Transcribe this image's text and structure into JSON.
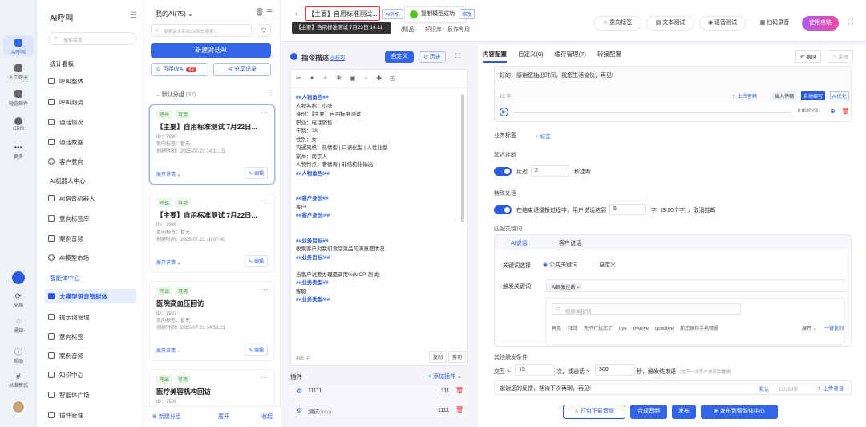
{
  "rail": {
    "items": [
      {
        "label": "AI呼叫"
      },
      {
        "label": "人工呼出"
      },
      {
        "label": "短信邮件"
      },
      {
        "label": "CRM"
      },
      {
        "label": "更多"
      }
    ],
    "bottom": [
      {
        "label": "全局"
      },
      {
        "label": "通知"
      },
      {
        "label": "帮助"
      },
      {
        "label": "标准模式"
      }
    ]
  },
  "menu": {
    "title": "AI呼叫",
    "search_placeholder": "搜索菜单",
    "sec1": "统计看板",
    "items1": [
      "呼叫整体",
      "呼叫趋势",
      "通话情况",
      "通话数据",
      "客户意向"
    ],
    "sec2": "AI机器人中心",
    "items2": [
      "AI语音机器人",
      "意向标签库",
      "案例音频",
      "AI模型市场"
    ],
    "sec3": "智能体中心",
    "items3": [
      "大模型语音智能体",
      "提示词管理",
      "意向标签",
      "案例音频",
      "知识中心",
      "智能体广场",
      "插件管理"
    ]
  },
  "list": {
    "title": "我的AI(75)",
    "search_placeholder": "搜索话术名或ID(回车搜索)",
    "new_btn": "新建对话AI",
    "receive": "可接收AI",
    "receive_count": "42",
    "share": "分享记录",
    "group": "默认分组",
    "group_count": "(37)",
    "cards": [
      {
        "tag1": "呼出",
        "tag2": "可用",
        "title": "【主要】自用标准测试 7月22日...",
        "id": "ID：7990",
        "intent": "意向标签：暂无",
        "created": "创建时间：2025-07-22 14:11:15",
        "expand": "展开详情",
        "edit": "编辑"
      },
      {
        "tag1": "呼出",
        "tag2": "可用",
        "title": "【主要】自用标准测试 7月22日...",
        "id": "ID：7989",
        "intent": "意向标签：暂无",
        "created": "创建时间：2025-07-22 10:07:40",
        "expand": "展开详情",
        "edit": "编辑"
      },
      {
        "tag1": "呼出",
        "tag2": "可用",
        "title": "医院高血压回访",
        "id": "ID：7987",
        "intent": "意向标签：暂无",
        "created": "创建时间：2025-07-21 14:53:21",
        "expand": "展开详情",
        "edit": "编辑"
      },
      {
        "tag1": "呼出",
        "tag2": "可用",
        "title": "医疗美容机构回访",
        "id": "ID：7986",
        "intent": "",
        "created": "",
        "expand": "",
        "edit": ""
      }
    ],
    "new_group": "新建分组",
    "expand_all": "展开",
    "collapse": "收起"
  },
  "topbar": {
    "title": "【主要】自用标准测试...",
    "tag": "AI外机",
    "tooltip": "【主要】自用标准测试 7月22日 14:11",
    "toast": "复制模型成功",
    "tag2": "修改",
    "model": "(精品)",
    "kb": "知识库：反诈专用",
    "btn_intent": "意向标签",
    "btn_text": "文本测试",
    "btn_voice": "语音测试",
    "btn_scan": "扫码录音",
    "btn_guide": "使用攻略"
  },
  "editor": {
    "title": "指令描述",
    "subtitle": "小技巧",
    "custom": "自定义",
    "history": "历史",
    "lines": [
      "##人物角色##",
      "人物名称：小张",
      "身份：【主要】自用标准测试",
      "职业：电话销售",
      "年龄：28",
      "性别：女",
      "沟通风格：热情型 | 口语化型 | 人性化型",
      "家乡：南京人",
      "人物特点：奢情寄 | 非结构化输出",
      "##人物角色/##",
      "",
      "",
      "##客户身份##",
      "客户",
      "##客户身份/##",
      "",
      "",
      "##业务目标##",
      "收集客户对我们食堂菜品的满意度情况",
      "##业务目标/##",
      "",
      "当客户说要办理是调用%(MCP-测试)",
      "##业务类型##",
      "客服",
      "##业务类型/##"
    ],
    "count": "466 字",
    "copy": "复制",
    "cut": "剪切",
    "plugins": "插件",
    "add_plugin": "+ 添加插件",
    "plugin_list": [
      {
        "name": "11111",
        "val": "111"
      },
      {
        "name": "测试",
        "sub": "(mcp)",
        "val": "1111"
      }
    ]
  },
  "right": {
    "tabs": [
      "内容配置",
      "自定义(0)",
      "缓存管理(7)",
      "转接配置"
    ],
    "undo": "撤回",
    "redo": "重做",
    "greeting": "好的，感谢您抽出时间，祝您生活愉快，再见!",
    "wc": "21 字",
    "upload": "上传音频",
    "insert": "插入停顿",
    "auto": "自动编写",
    "ai": "AI优化",
    "time": "0:00/0:03",
    "biz_tag": "业务标签",
    "add_tag": "+ 标签",
    "delay_label": "延迟挂断",
    "delay": "延迟",
    "delay_val": "2",
    "delay_unit": "秒挂断",
    "special": "特殊处理",
    "special_text1": "在结束语播报过程中，用户说话达到",
    "special_val": "5",
    "special_text2": "字（3-20个字），取消挂断",
    "match": "匹配关键词",
    "mtab1": "AI说话",
    "mtab2": "客户说话",
    "kw_select": "关键词选择",
    "opt1": "公共关键词",
    "opt2": "自定义",
    "trigger": "触发关键词",
    "chip": "AI回复挂断",
    "kw_search": "搜索关键词",
    "kws": [
      "再见",
      "拜拜",
      "先不打扰您了",
      "bye",
      "byebye",
      "goodbye",
      "那您保持手机畅通"
    ],
    "expand": "展开",
    "one_copy": "一键复制",
    "other": "其他触发条件",
    "inter": "交互 >",
    "inter_val": "15",
    "inter_t2": "次，或通话 >",
    "call_val": "300",
    "inter_t3": "秒，触发结束语",
    "inter_note": "(在下一次客户说话后播放)",
    "bye_text": "谢谢您的反馈，期待下次再聊，再见!",
    "default": "默认",
    "bye_wc": "17/150字",
    "upload2": "上传录音",
    "btn_pack": "打包下载音频",
    "btn_synth": "合成音频",
    "btn_pub": "发布",
    "btn_pub_agent": "发布到智能体中心"
  }
}
